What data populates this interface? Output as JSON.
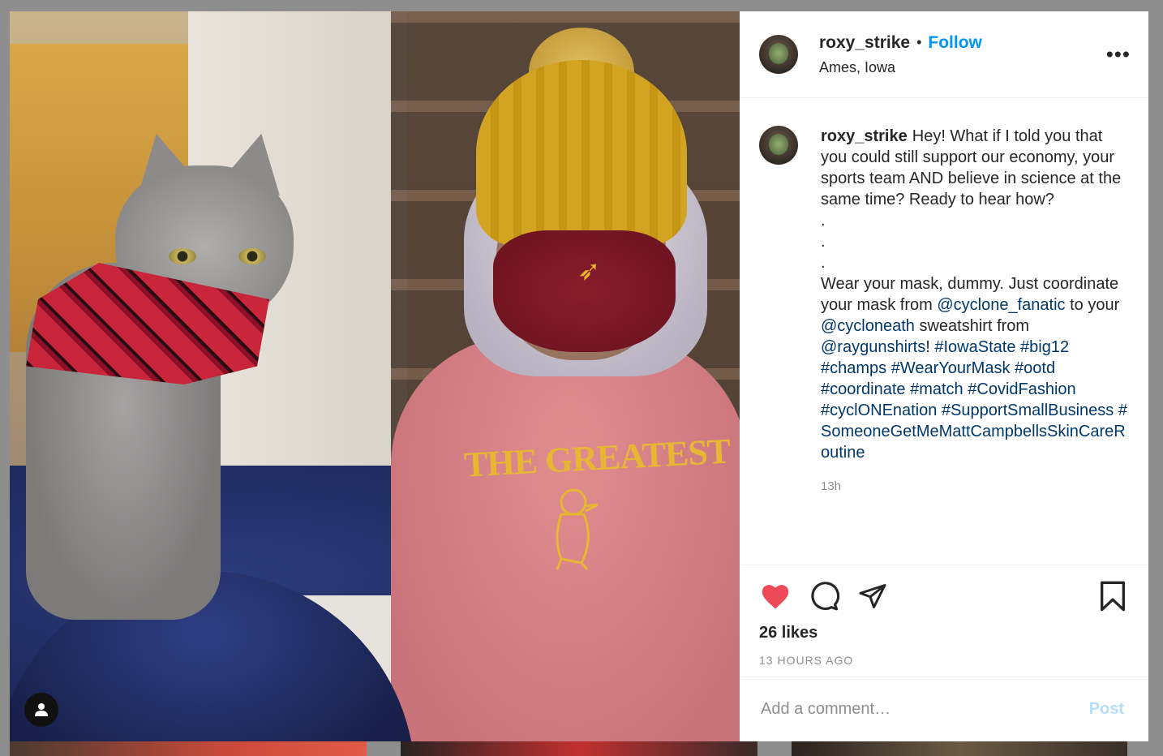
{
  "post": {
    "username": "roxy_strike",
    "separator": "•",
    "follow_label": "Follow",
    "location": "Ames, Iowa",
    "more_label": "•••"
  },
  "caption": {
    "username": "roxy_strike",
    "text_part1": "Hey! What if I told you that you could still support our economy, your sports team AND believe in science at the same time? Ready to hear how?",
    "dots": [
      ".",
      ".",
      "."
    ],
    "text_part2": "Wear your mask, dummy. Just coordinate your mask from",
    "mention1": "@cyclone_fanatic",
    "text_part3": "to your",
    "mention2": "@cycloneath",
    "text_part4": "sweatshirt from",
    "mention3": "@raygunshirts",
    "text_part5": "!",
    "hashtags": [
      "#IowaState",
      "#big12",
      "#champs",
      "#WearYourMask",
      "#ootd",
      "#coordinate",
      "#match",
      "#CovidFashion",
      "#cyclONEnation",
      "#SupportSmallBusiness",
      "#SomeoneGetMeMattCampbellsSkinCareRoutine"
    ],
    "time": "13h"
  },
  "actions": {
    "likes": "26 likes",
    "time_ago": "13 HOURS AGO",
    "like_icon": "heart-filled-icon",
    "comment_icon": "comment-icon",
    "share_icon": "send-icon",
    "save_icon": "bookmark-icon"
  },
  "comment": {
    "placeholder": "Add a comment…",
    "post_label": "Post"
  },
  "colors": {
    "accent": "#0095f6",
    "like": "#ed4956",
    "link": "#00376b",
    "post_disabled": "#b2dffc"
  }
}
